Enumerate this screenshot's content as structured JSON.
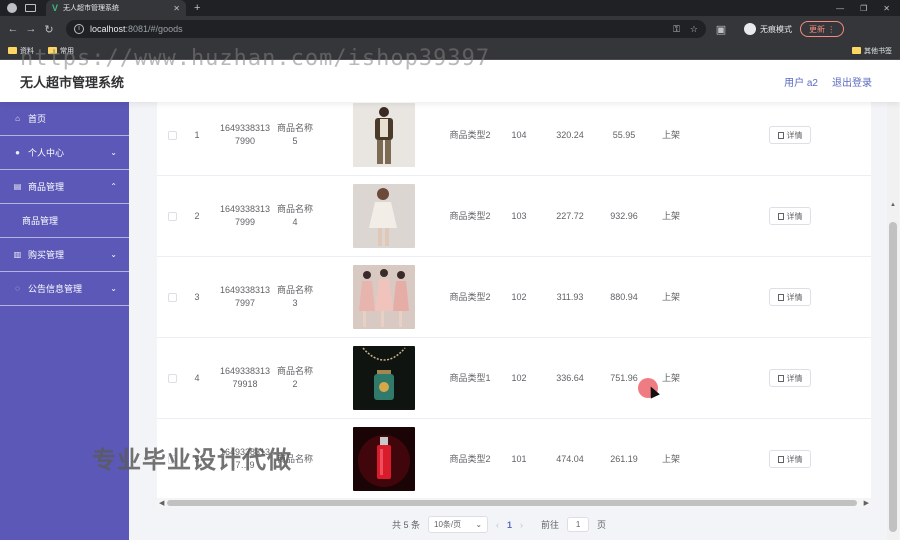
{
  "browser": {
    "tab_title": "无人超市管理系统",
    "url_host": "localhost",
    "url_path": ":8081/#/goods",
    "incognito_label": "无痕模式",
    "update_label": "更新",
    "bookmarks": [
      "资料",
      "常用"
    ],
    "other_bookmarks": "其他书签"
  },
  "watermarks": {
    "top": "https://www.huzhan.com/ishop39397",
    "bottom": "专业毕业设计代做"
  },
  "header": {
    "title": "无人超市管理系统",
    "user": "用户 a2",
    "logout": "退出登录"
  },
  "sidebar": {
    "items": [
      {
        "label": "首页",
        "icon": "home-icon"
      },
      {
        "label": "个人中心",
        "icon": "user-icon"
      },
      {
        "label": "商品管理",
        "icon": "shop-icon"
      },
      {
        "label": "商品管理"
      },
      {
        "label": "购买管理",
        "icon": "cart-icon"
      },
      {
        "label": "公告信息管理",
        "icon": "notice-icon"
      }
    ]
  },
  "table": {
    "rows": [
      {
        "index": "1",
        "code": "16493383137990",
        "name": "商品名称5",
        "type": "商品类型2",
        "col5": "104",
        "col6": "320.24",
        "col7": "55.95",
        "status": "上架",
        "image": "brown-jacket-man"
      },
      {
        "index": "2",
        "code": "16493383137999",
        "name": "商品名称4",
        "type": "商品类型2",
        "col5": "103",
        "col6": "227.72",
        "col7": "932.96",
        "status": "上架",
        "image": "white-dress-woman"
      },
      {
        "index": "3",
        "code": "16493383137997",
        "name": "商品名称3",
        "type": "商品类型2",
        "col5": "102",
        "col6": "311.93",
        "col7": "880.94",
        "status": "上架",
        "image": "pink-dresses-group"
      },
      {
        "index": "4",
        "code": "164933831379918",
        "name": "商品名称2",
        "type": "商品类型1",
        "col5": "102",
        "col6": "336.64",
        "col7": "751.96",
        "status": "上架",
        "image": "jade-pendant"
      },
      {
        "index": "5",
        "code": "16493383137…9",
        "name": "商品名称",
        "type": "商品类型2",
        "col5": "101",
        "col6": "474.04",
        "col7": "261.19",
        "status": "上架",
        "image": "red-perfume"
      }
    ],
    "detail_label": "详情"
  },
  "pager": {
    "total": "共 5 条",
    "page_size": "10条/页",
    "current": "1",
    "goto_label": "前往",
    "goto_value": "1",
    "page_unit": "页"
  }
}
